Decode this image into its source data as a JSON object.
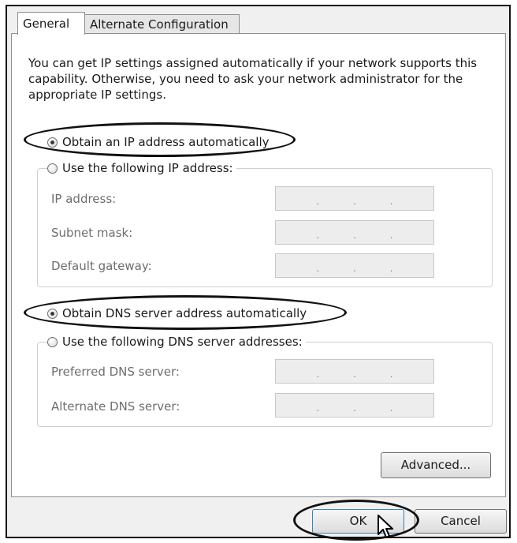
{
  "tabs": [
    {
      "label": "General",
      "active": true
    },
    {
      "label": "Alternate Configuration",
      "active": false
    }
  ],
  "description": "You can get IP settings assigned automatically if your network supports this capability. Otherwise, you need to ask your network administrator for the appropriate IP settings.",
  "ip_section": {
    "auto_label": "Obtain an IP address automatically",
    "auto_selected": true,
    "manual_label": "Use the following IP address:",
    "fields": [
      {
        "label": "IP address:",
        "value": ".    .    ."
      },
      {
        "label": "Subnet mask:",
        "value": ".    .    ."
      },
      {
        "label": "Default gateway:",
        "value": ".    .    ."
      }
    ]
  },
  "dns_section": {
    "auto_label": "Obtain DNS server address automatically",
    "auto_selected": true,
    "manual_label": "Use the following DNS server addresses:",
    "fields": [
      {
        "label": "Preferred DNS server:",
        "value": ".    .    ."
      },
      {
        "label": "Alternate DNS server:",
        "value": ".    .    ."
      }
    ]
  },
  "buttons": {
    "advanced": "Advanced...",
    "ok": "OK",
    "cancel": "Cancel"
  },
  "icons": {
    "cursor": "arrow-cursor-icon",
    "radio": "radio-button"
  },
  "colors": {
    "disabled_text": "#6e6e6e",
    "field_disabled_bg": "#ededed",
    "highlight_oval": "#111111"
  }
}
